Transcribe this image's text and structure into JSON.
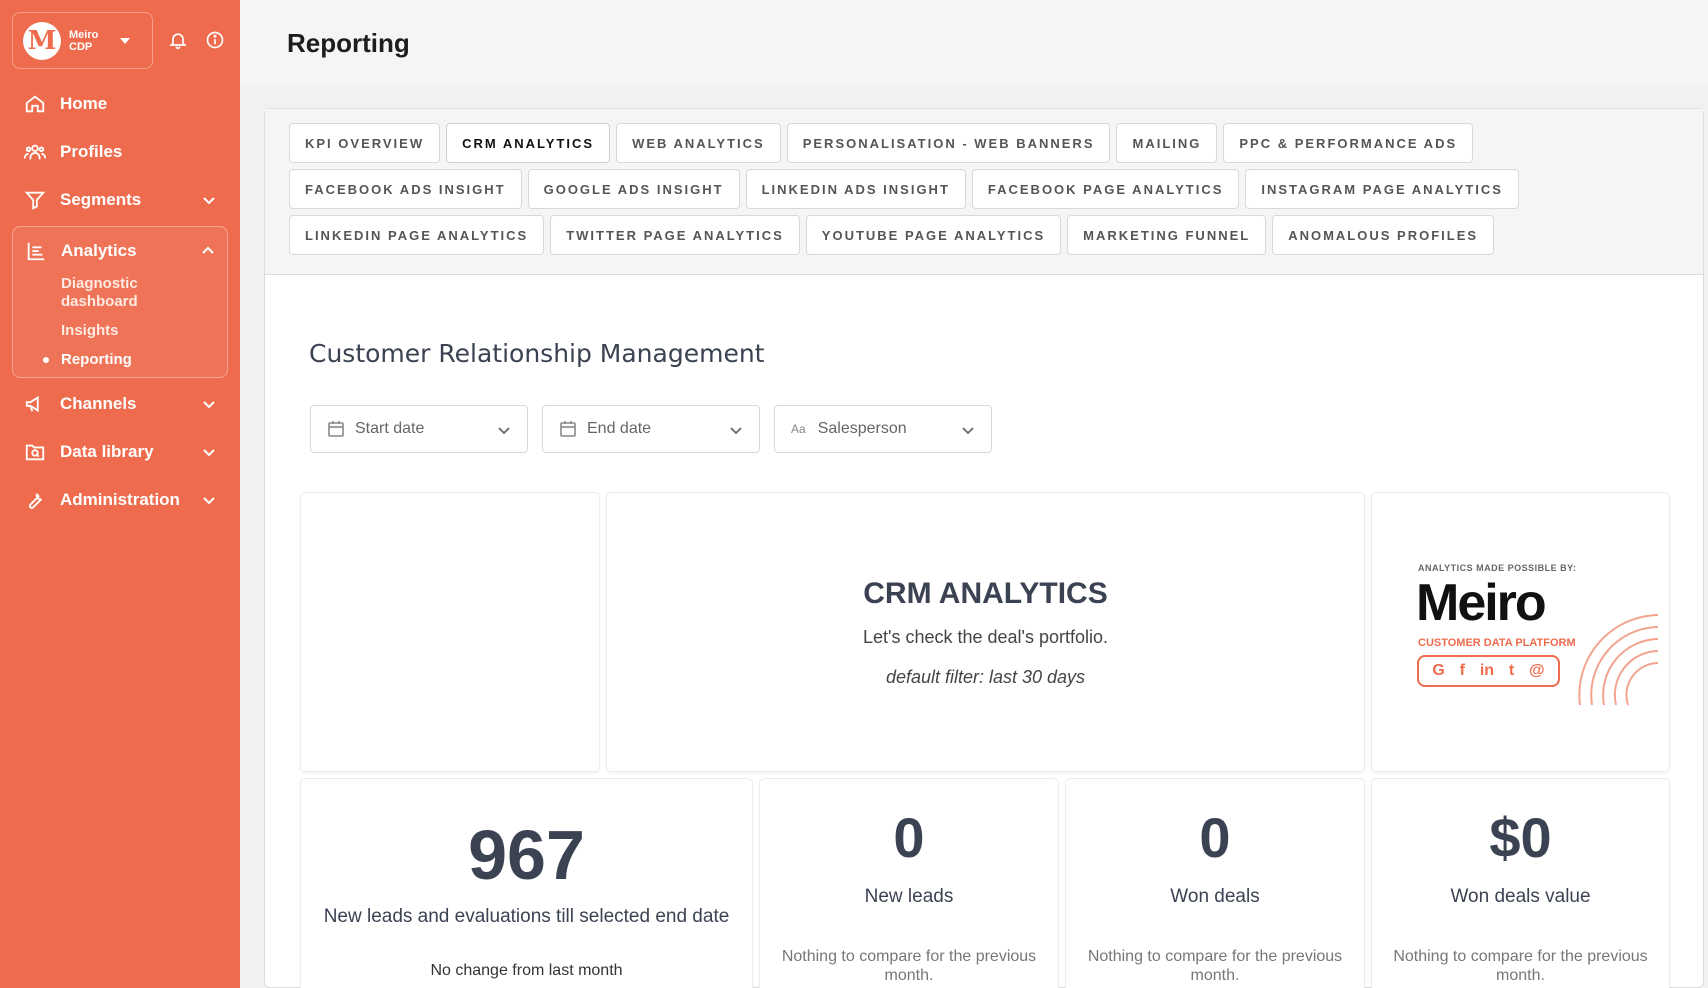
{
  "brand": {
    "line1": "Meiro",
    "line2": "CDP",
    "logo_letter": "M"
  },
  "page_title": "Reporting",
  "nav": {
    "home": "Home",
    "profiles": "Profiles",
    "segments": "Segments",
    "analytics": "Analytics",
    "analytics_sub": [
      "Diagnostic dashboard",
      "Insights",
      "Reporting"
    ],
    "channels": "Channels",
    "data_library": "Data library",
    "administration": "Administration"
  },
  "tabs": {
    "row1": [
      "KPI OVERVIEW",
      "CRM ANALYTICS",
      "WEB ANALYTICS",
      "PERSONALISATION - WEB BANNERS",
      "MAILING",
      "PPC & PERFORMANCE ADS"
    ],
    "row2": [
      "FACEBOOK ADS INSIGHT",
      "GOOGLE ADS INSIGHT",
      "LINKEDIN ADS INSIGHT",
      "FACEBOOK PAGE ANALYTICS",
      "INSTAGRAM PAGE ANALYTICS"
    ],
    "row3": [
      "LINKEDIN PAGE ANALYTICS",
      "TWITTER PAGE ANALYTICS",
      "YOUTUBE PAGE ANALYTICS",
      "MARKETING FUNNEL",
      "ANOMALOUS PROFILES"
    ],
    "active": "CRM ANALYTICS"
  },
  "section_title": "Customer Relationship Management",
  "filters": {
    "start_date": "Start date",
    "end_date": "End date",
    "salesperson": "Salesperson",
    "text_icon": "Aa"
  },
  "crm_card": {
    "title": "CRM ANALYTICS",
    "subtitle": "Let's check the deal's portfolio.",
    "filter_note": "default filter: last 30 days"
  },
  "logo_card": {
    "small_text": "ANALYTICS MADE POSSIBLE BY:",
    "big_text": "Meiro",
    "sub_text": "CUSTOMER DATA PLATFORM",
    "socials": [
      "G",
      "f",
      "in",
      "t",
      "@"
    ]
  },
  "kpis": {
    "total": {
      "value": "967",
      "label": "New leads and evaluations till selected end date",
      "note": "No change from last month"
    },
    "new_leads": {
      "value": "0",
      "label": "New leads",
      "note": "Nothing to compare for the previous month."
    },
    "won_deals": {
      "value": "0",
      "label": "Won deals",
      "note": "Nothing to compare for the previous month."
    },
    "won_value": {
      "value": "$0",
      "label": "Won deals value",
      "note": "Nothing to compare for the previous month."
    }
  },
  "colors": {
    "sidebar": "#ee6c4d",
    "text_dark": "#3b4252"
  }
}
